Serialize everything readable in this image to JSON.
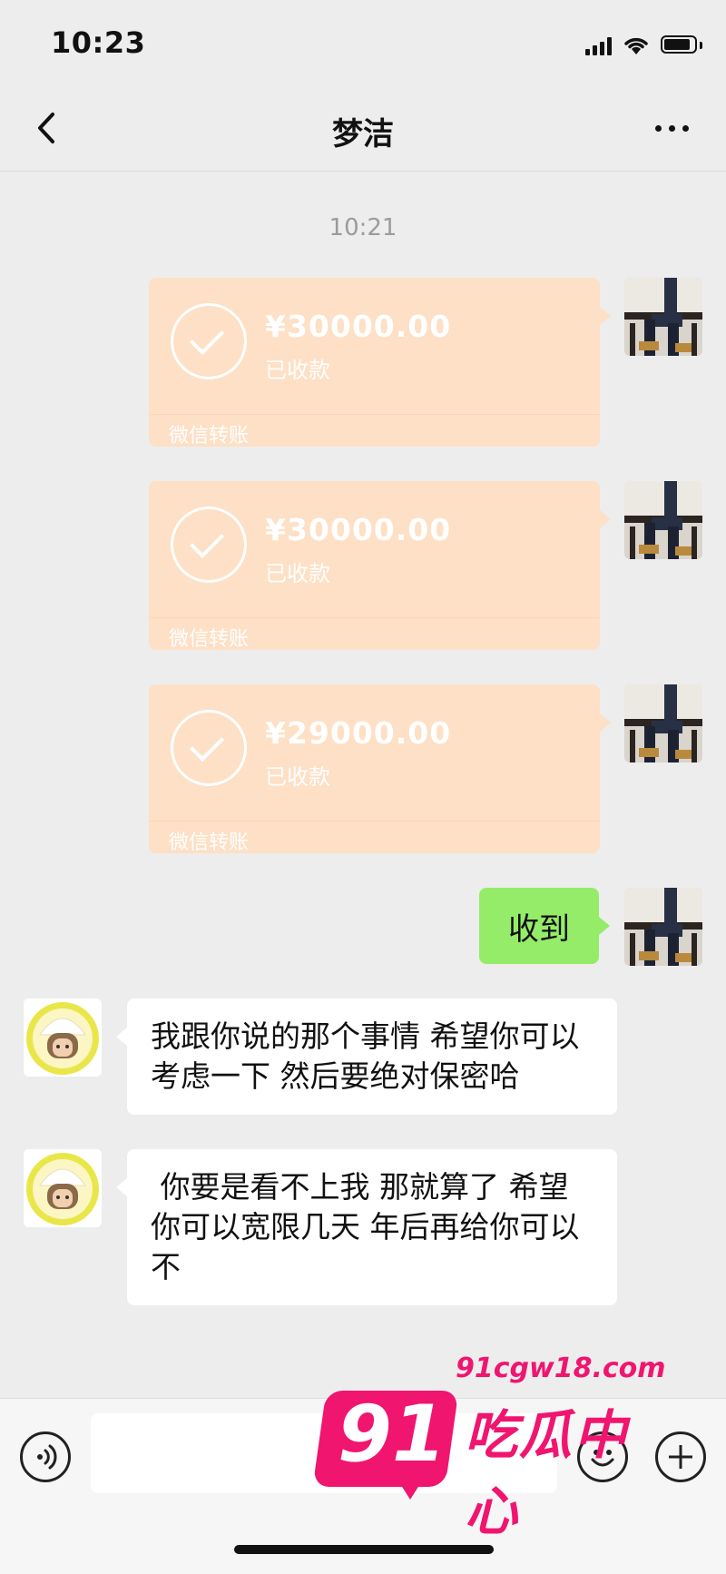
{
  "status_bar": {
    "time": "10:23"
  },
  "header": {
    "title": "梦洁"
  },
  "chat": {
    "timestamp": "10:21",
    "transfers": [
      {
        "amount": "¥30000.00",
        "status": "已收款",
        "footer": "微信转账"
      },
      {
        "amount": "¥30000.00",
        "status": "已收款",
        "footer": "微信转账"
      },
      {
        "amount": "¥29000.00",
        "status": "已收款",
        "footer": "微信转账"
      }
    ],
    "sent_text": "收到",
    "received_messages": [
      "我跟你说的那个事情 希望你可以考虑一下 然后要绝对保密哈",
      " 你要是看不上我 那就算了 希望你可以宽限几天 年后再给你可以不"
    ]
  },
  "input": {
    "value": "",
    "placeholder": ""
  },
  "watermark": {
    "number": "91",
    "url": "91cgw18.com",
    "brand": "吃瓜中心"
  },
  "colors": {
    "background": "#ededed",
    "transfer_bubble": "#fde0c5",
    "sent_bubble": "#95ec69",
    "received_bubble": "#ffffff",
    "watermark": "#f0156f"
  }
}
